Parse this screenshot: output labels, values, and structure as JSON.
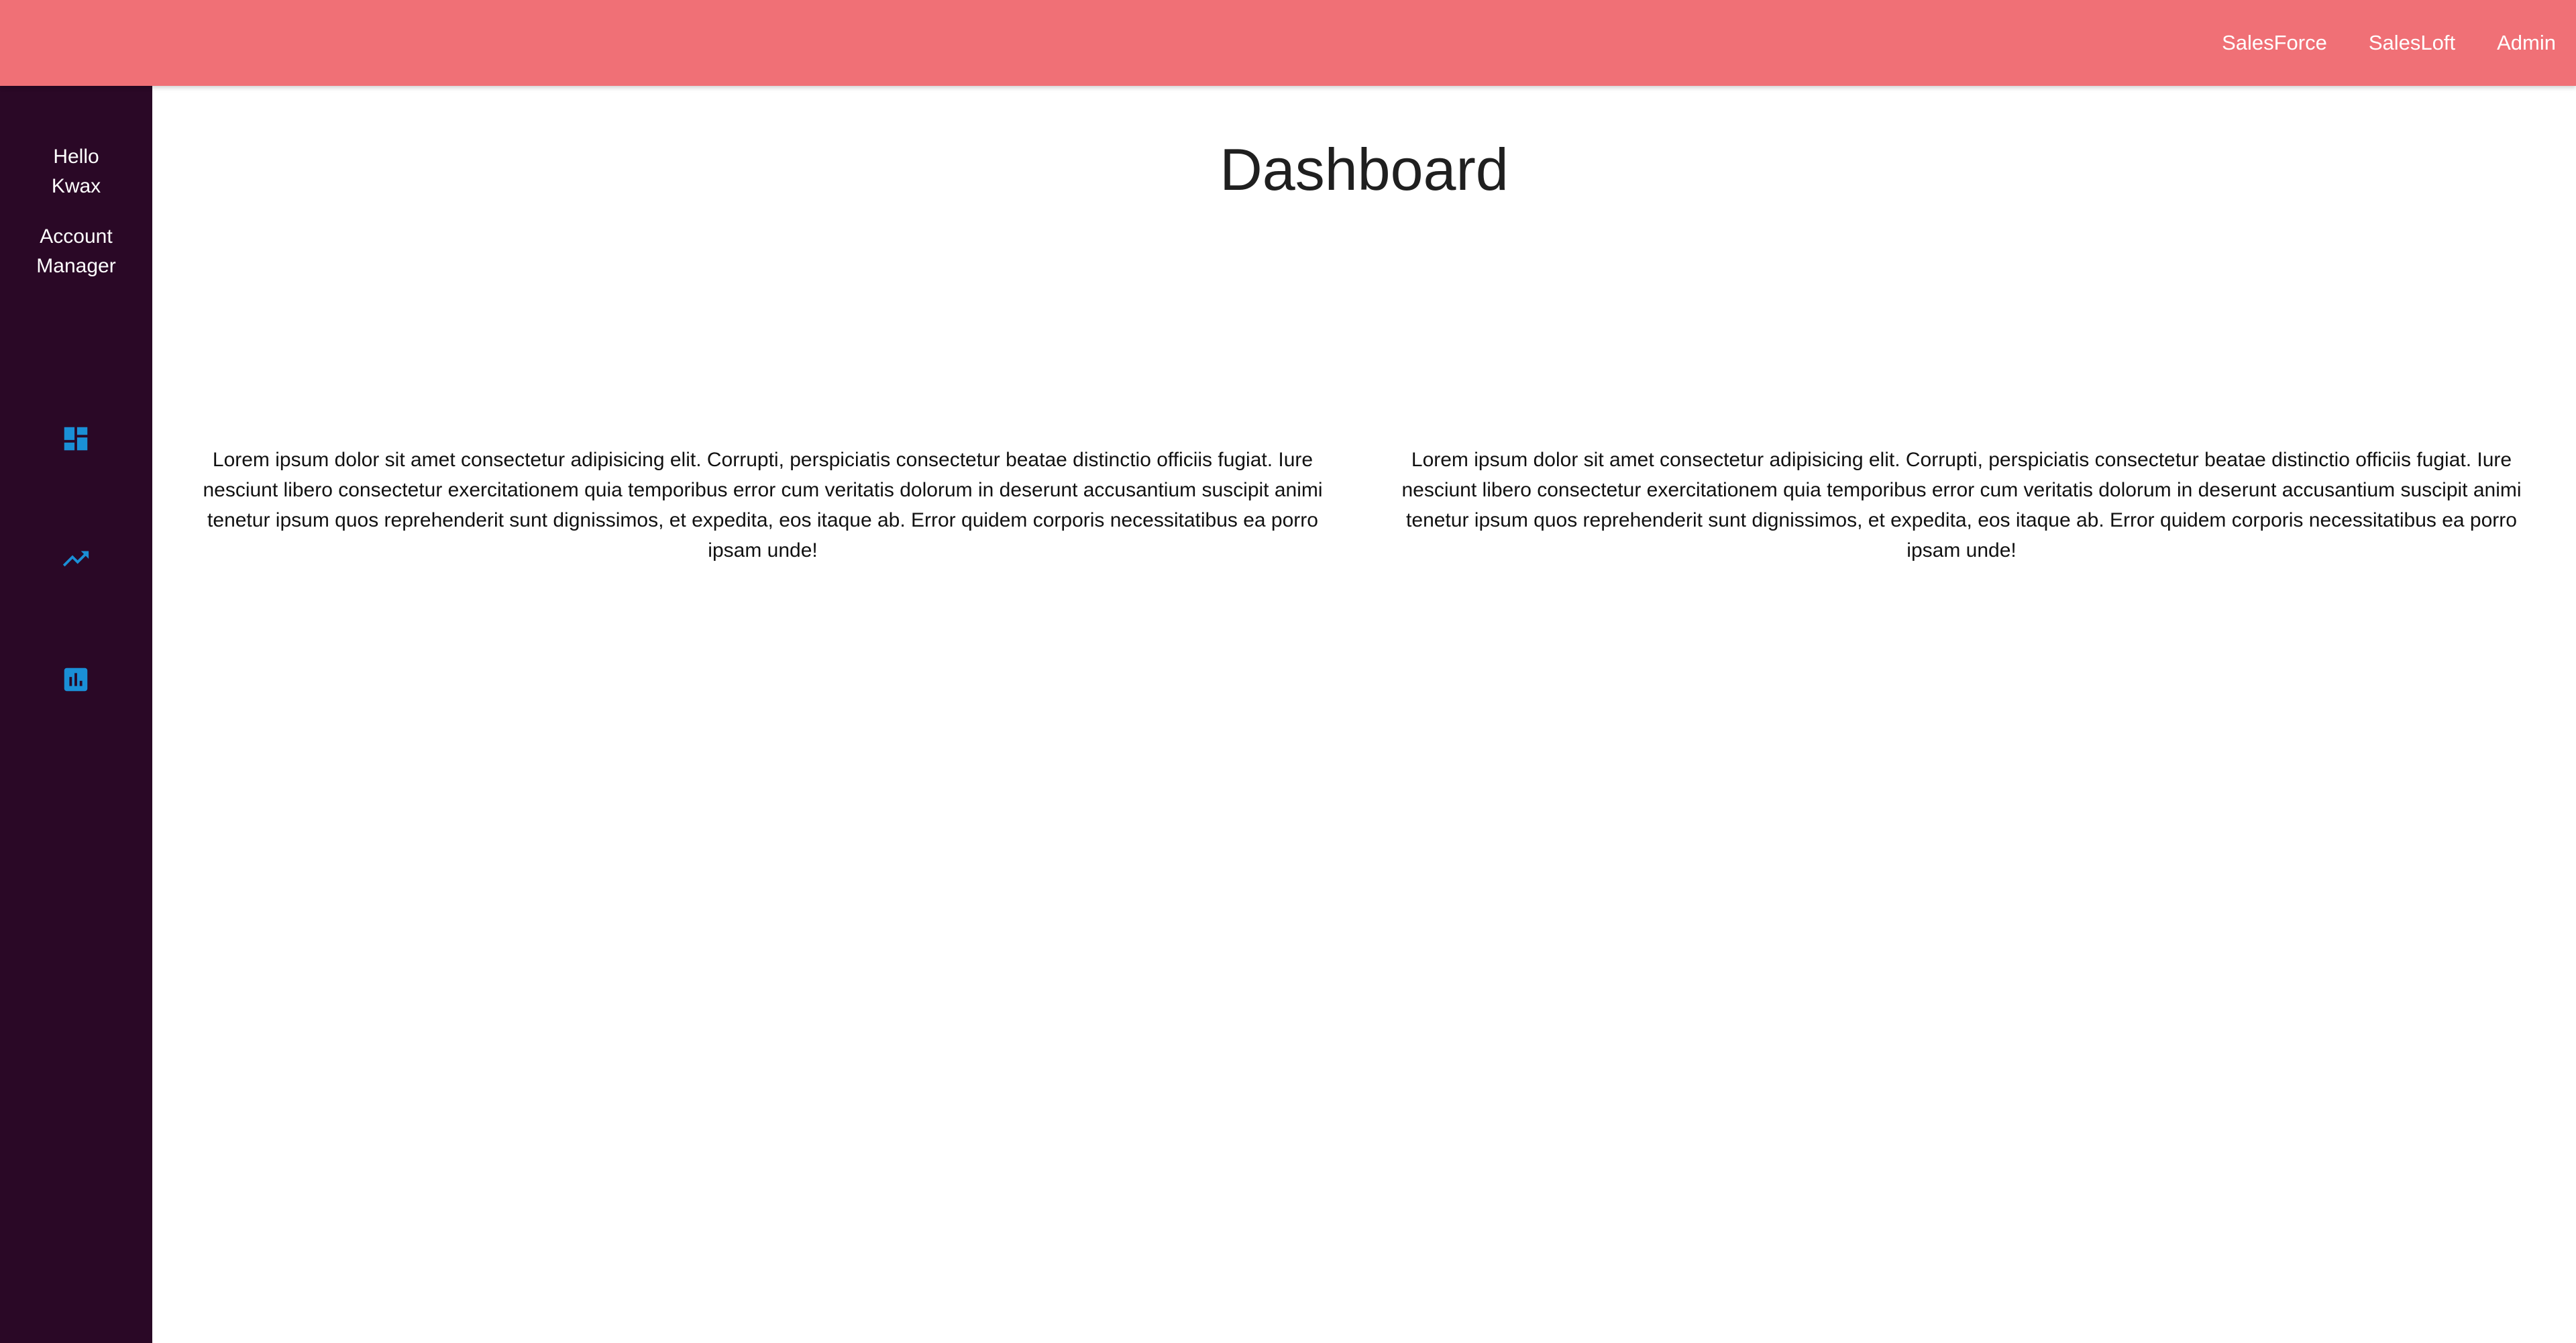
{
  "topnav": {
    "links": [
      "SalesForce",
      "SalesLoft",
      "Admin"
    ]
  },
  "sidebar": {
    "greeting": [
      "Hello",
      "Kwax"
    ],
    "role": [
      "Account",
      "Manager"
    ],
    "icons": [
      "dashboard-icon",
      "trending-up-icon",
      "bar-chart-icon"
    ],
    "icon_color": "#1a8fd6"
  },
  "main": {
    "title": "Dashboard",
    "paragraphs": [
      "Lorem ipsum dolor sit amet consectetur adipisicing elit. Corrupti, perspiciatis consectetur beatae distinctio officiis fugiat. Iure nesciunt libero consectetur exercitationem quia temporibus error cum veritatis dolorum in deserunt accusantium suscipit animi tenetur ipsum quos reprehenderit sunt dignissimos, et expedita, eos itaque ab. Error quidem corporis necessitatibus ea porro ipsam unde!",
      "Lorem ipsum dolor sit amet consectetur adipisicing elit. Corrupti, perspiciatis consectetur beatae distinctio officiis fugiat. Iure nesciunt libero consectetur exercitationem quia temporibus error cum veritatis dolorum in deserunt accusantium suscipit animi tenetur ipsum quos reprehenderit sunt dignissimos, et expedita, eos itaque ab. Error quidem corporis necessitatibus ea porro ipsam unde!"
    ]
  },
  "colors": {
    "topbar": "#f07076",
    "sidebar": "#2a0826",
    "accent": "#1a8fd6"
  }
}
